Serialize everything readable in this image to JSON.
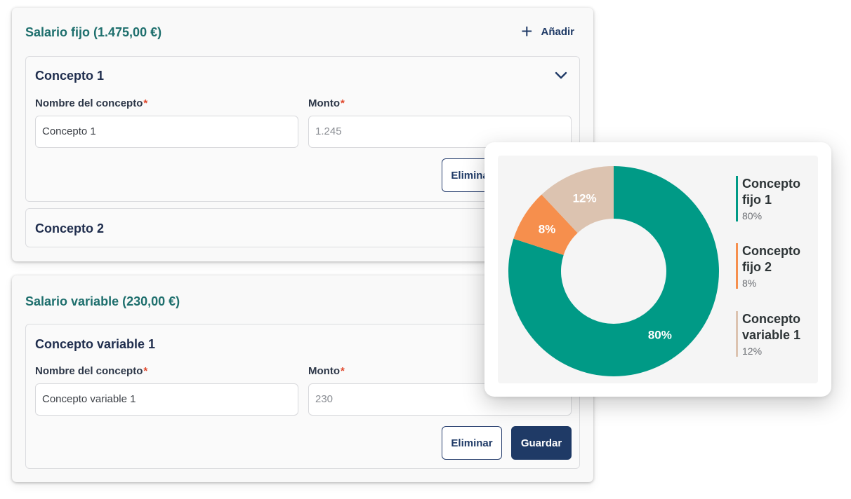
{
  "fijo": {
    "title": "Salario fijo (1.475,00 €)",
    "add_label": "Añadir",
    "concept1": {
      "title": "Concepto 1",
      "name_label": "Nombre del concepto",
      "amount_label": "Monto",
      "required_mark": "*",
      "name_value": "Concepto 1",
      "amount_value": "1.245",
      "delete_label": "Eliminar"
    },
    "concept2": {
      "title": "Concepto 2"
    }
  },
  "variable": {
    "title": "Salario variable (230,00 €)",
    "concept1": {
      "title": "Concepto variable 1",
      "name_label": "Nombre del concepto",
      "amount_label": "Monto",
      "required_mark": "*",
      "name_value": "Concepto variable 1",
      "amount_value": "230",
      "delete_label": "Eliminar",
      "save_label": "Guardar"
    }
  },
  "colors": {
    "teal": "#009a86",
    "orange": "#f68f4d",
    "beige": "#dcc3b0",
    "navy": "#1f3a66",
    "title_teal": "#1e6f6d"
  },
  "chart_data": {
    "type": "pie",
    "categories": [
      "Concepto fijo 1",
      "Concepto fijo 2",
      "Concepto variable 1"
    ],
    "values": [
      80,
      8,
      12
    ],
    "labels": [
      "80%",
      "8%",
      "12%"
    ],
    "legend_values": [
      "80%",
      "8%",
      "12%"
    ],
    "colors": [
      "#009a86",
      "#f68f4d",
      "#dcc3b0"
    ],
    "legend_position": "right"
  }
}
